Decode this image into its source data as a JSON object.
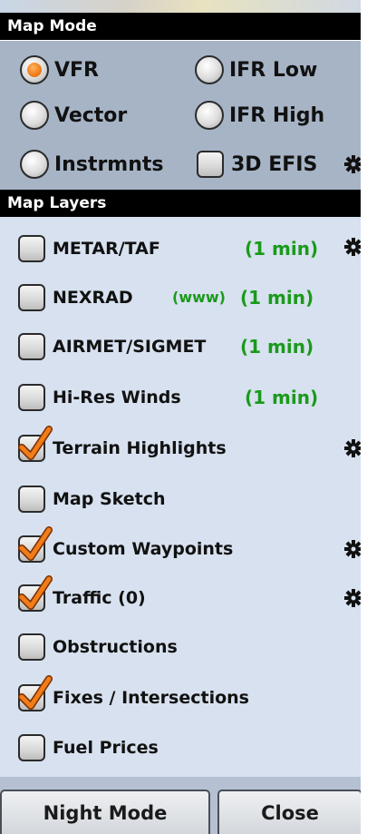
{
  "map_mode": {
    "header": "Map Mode",
    "options": [
      {
        "label": "VFR",
        "selected": true
      },
      {
        "label": "IFR Low",
        "selected": false
      },
      {
        "label": "Vector",
        "selected": false
      },
      {
        "label": "IFR High",
        "selected": false
      },
      {
        "label": "Instrmnts",
        "selected": false
      }
    ],
    "efis": {
      "label": "3D EFIS",
      "checked": false
    }
  },
  "map_layers": {
    "header": "Map Layers",
    "items": [
      {
        "label": "METAR/TAF",
        "www": "",
        "age": "(1 min)",
        "checked": false
      },
      {
        "label": "NEXRAD",
        "www": "(www)",
        "age": "(1 min)",
        "checked": false
      },
      {
        "label": "AIRMET/SIGMET",
        "www": "",
        "age": "(1 min)",
        "checked": false
      },
      {
        "label": "Hi-Res Winds",
        "www": "",
        "age": "(1 min)",
        "checked": false
      },
      {
        "label": "Terrain Highlights",
        "www": "",
        "age": "",
        "checked": true
      },
      {
        "label": "Map Sketch",
        "www": "",
        "age": "",
        "checked": false
      },
      {
        "label": "Custom Waypoints",
        "www": "",
        "age": "",
        "checked": true
      },
      {
        "label": "Traffic (0)",
        "www": "",
        "age": "",
        "checked": true
      },
      {
        "label": "Obstructions",
        "www": "",
        "age": "",
        "checked": false
      },
      {
        "label": "Fixes / Intersections",
        "www": "",
        "age": "",
        "checked": true
      },
      {
        "label": "Fuel Prices",
        "www": "",
        "age": "",
        "checked": false
      }
    ]
  },
  "buttons": {
    "night_mode": "Night Mode",
    "close": "Close"
  },
  "colors": {
    "accent_orange": "#f07d1a",
    "status_green": "#1a9a1a",
    "panel_blue": "#a6b4c6",
    "layers_bg": "#d7e1ef"
  }
}
